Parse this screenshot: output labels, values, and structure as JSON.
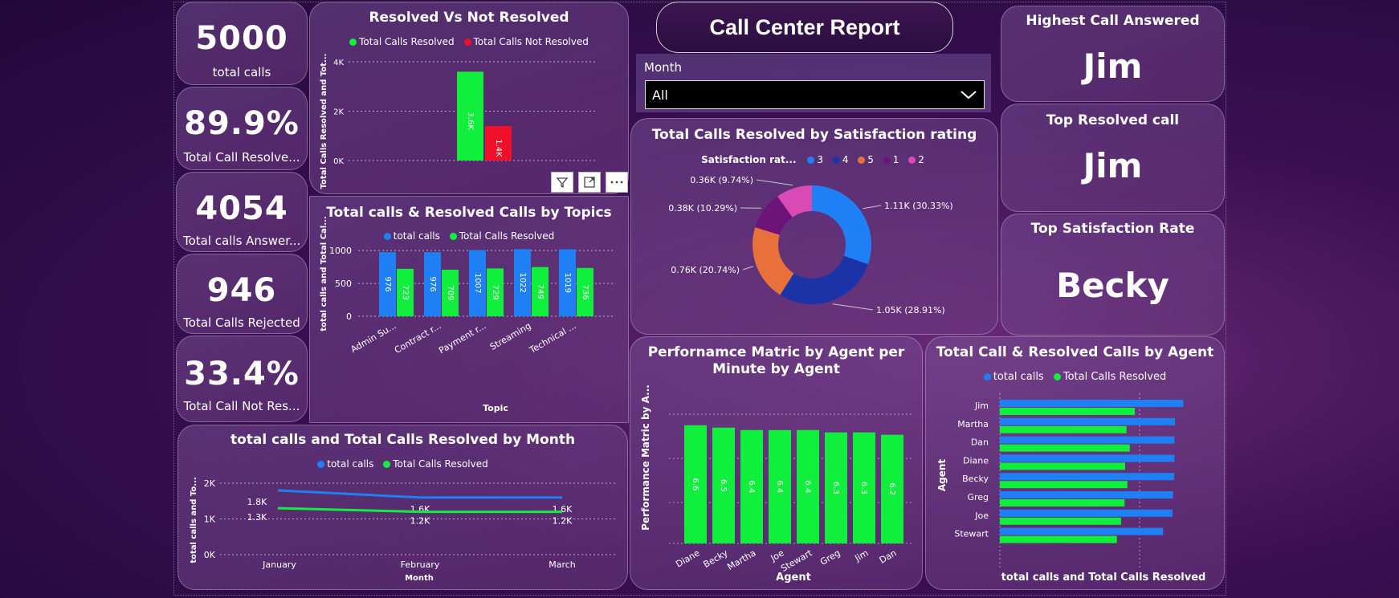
{
  "header": {
    "title": "Call Center Report"
  },
  "slicer": {
    "label": "Month",
    "value": "All"
  },
  "kpis": [
    {
      "value": "5000",
      "label": "total calls"
    },
    {
      "value": "89.9%",
      "label": "Total Call Resolve..."
    },
    {
      "value": "4054",
      "label": "Total calls Answer..."
    },
    {
      "value": "946",
      "label": "Total Calls Rejected"
    },
    {
      "value": "33.4%",
      "label": "Total Call Not Res..."
    }
  ],
  "highlights": [
    {
      "title": "Highest Call Answered",
      "value": "Jim"
    },
    {
      "title": "Top Resolved call",
      "value": "Jim"
    },
    {
      "title": "Top Satisfaction Rate",
      "value": "Becky"
    }
  ],
  "colors": {
    "blue": "#1f7ff5",
    "green": "#11ef3d",
    "red": "#f0102a",
    "darkblue": "#1c33a8",
    "orange": "#e8703a",
    "purple": "#6d1478",
    "pink": "#d94ab5"
  },
  "chart_data": [
    {
      "id": "resolved_vs_not",
      "type": "bar",
      "title": "Resolved Vs Not Resolved",
      "ylabel": "Total Calls Resolved and Tot...",
      "yticks": [
        "0K",
        "2K",
        "4K"
      ],
      "ylim": [
        0,
        4000
      ],
      "series": [
        {
          "name": "Total Calls Resolved",
          "values": [
            3600
          ],
          "label": "3.6K"
        },
        {
          "name": "Total Calls Not Resolved",
          "values": [
            1400
          ],
          "label": "1.4K"
        }
      ]
    },
    {
      "id": "topics",
      "type": "bar",
      "title": "Total calls & Resolved Calls by Topics",
      "xlabel": "Topic",
      "ylabel": "total calls and Total Cal...",
      "yticks": [
        "0",
        "500",
        "1000"
      ],
      "ylim": [
        0,
        1100
      ],
      "categories": [
        "Admin Su...",
        "Contract r...",
        "Payment r...",
        "Streaming",
        "Technical ..."
      ],
      "series": [
        {
          "name": "total calls",
          "values": [
            976,
            976,
            1007,
            1022,
            1019
          ]
        },
        {
          "name": "Total Calls Resolved",
          "values": [
            723,
            709,
            729,
            749,
            736
          ]
        }
      ]
    },
    {
      "id": "satisfaction",
      "type": "pie",
      "title": "Total Calls Resolved by Satisfaction rating",
      "legend_title": "Satisfaction rat...",
      "slices": [
        {
          "name": "3",
          "value": 1110,
          "label": "1.11K (30.33%)"
        },
        {
          "name": "4",
          "value": 1050,
          "label": "1.05K (28.91%)"
        },
        {
          "name": "5",
          "value": 760,
          "label": "0.76K (20.74%)"
        },
        {
          "name": "1",
          "value": 380,
          "label": "0.38K (10.29%)"
        },
        {
          "name": "2",
          "value": 360,
          "label": "0.36K (9.74%)"
        }
      ]
    },
    {
      "id": "month",
      "type": "line",
      "title": "total calls and Total Calls Resolved by Month",
      "xlabel": "Month",
      "ylabel": "total calls and To...",
      "yticks": [
        "0K",
        "1K",
        "2K"
      ],
      "ylim": [
        0,
        2000
      ],
      "categories": [
        "January",
        "February",
        "March"
      ],
      "series": [
        {
          "name": "total calls",
          "values": [
            1800,
            1600,
            1600
          ],
          "labels": [
            "1.8K",
            "1.6K",
            "1.6K"
          ]
        },
        {
          "name": "Total Calls Resolved",
          "values": [
            1300,
            1200,
            1200
          ],
          "labels": [
            "1.3K",
            "1.2K",
            "1.2K"
          ]
        }
      ]
    },
    {
      "id": "performance",
      "type": "bar",
      "title": "Perfornamce Matric by Agent per Minute by Agent",
      "xlabel": "Agent",
      "ylabel": "Performance Matric by A...",
      "ylim": [
        0,
        7
      ],
      "categories": [
        "Diane",
        "Becky",
        "Martha",
        "Joe",
        "Stewart",
        "Greg",
        "Jim",
        "Dan"
      ],
      "values": [
        6.6,
        6.5,
        6.4,
        6.4,
        6.4,
        6.3,
        6.3,
        6.2
      ]
    },
    {
      "id": "agent_calls",
      "type": "bar",
      "title": "Total Call & Resolved Calls by Agent",
      "xlabel": "total calls and Total Calls Resolved",
      "ylabel": "Agent",
      "xlim": [
        0,
        700
      ],
      "categories": [
        "Jim",
        "Martha",
        "Dan",
        "Diane",
        "Becky",
        "Greg",
        "Joe",
        "Stewart"
      ],
      "series": [
        {
          "name": "total calls",
          "values": [
            666,
            636,
            634,
            634,
            633,
            629,
            627,
            593
          ]
        },
        {
          "name": "Total Calls Resolved",
          "values": [
            490,
            460,
            472,
            455,
            463,
            453,
            440,
            425
          ]
        }
      ]
    }
  ]
}
